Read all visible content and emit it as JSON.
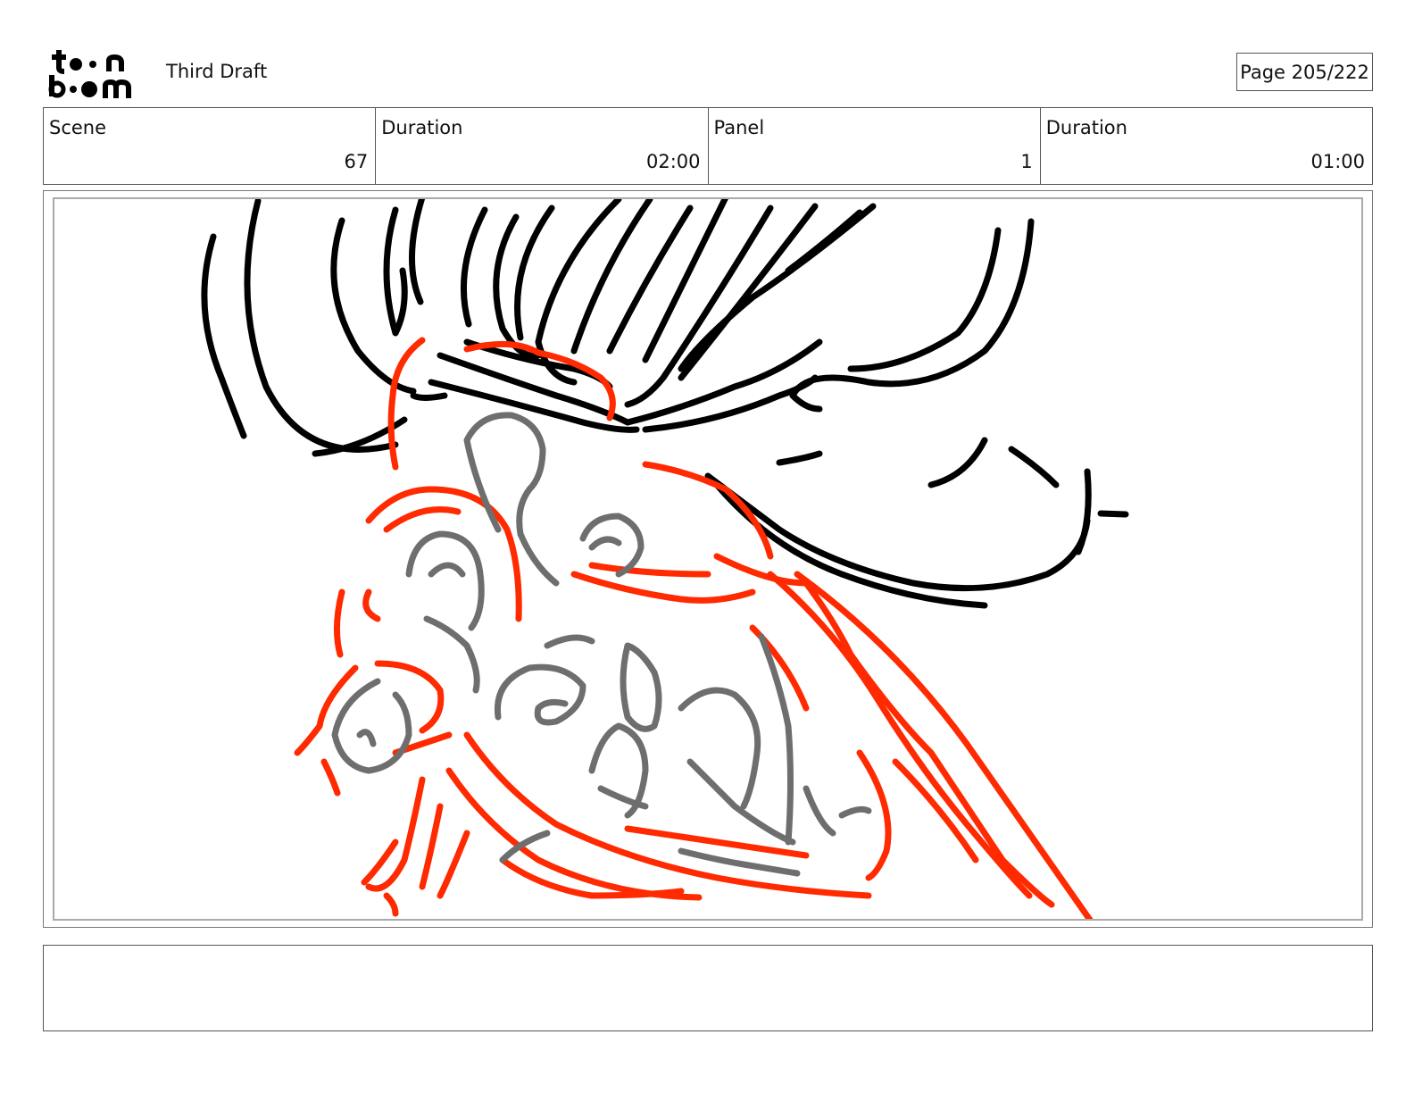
{
  "header": {
    "logo_text": "toon boom",
    "doc_title": "Third Draft",
    "page_label": "Page 205/222"
  },
  "info": [
    {
      "label": "Scene",
      "value": "67"
    },
    {
      "label": "Duration",
      "value": "02:00"
    },
    {
      "label": "Panel",
      "value": "1"
    },
    {
      "label": "Duration",
      "value": "01:00"
    }
  ],
  "panel": {
    "sketch_layers": [
      "black",
      "red",
      "gray"
    ],
    "colors": {
      "black": "#000000",
      "red": "#ff2a00",
      "gray": "#6e6e6e"
    }
  },
  "notes": {
    "text": ""
  }
}
